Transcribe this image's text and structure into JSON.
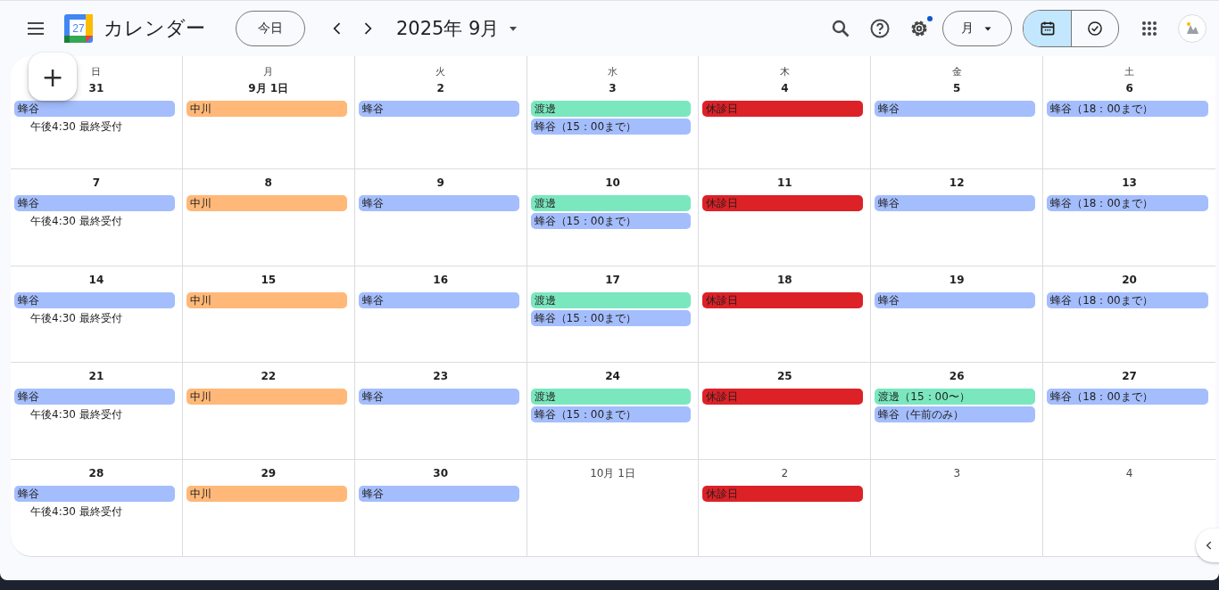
{
  "header": {
    "app_name": "カレンダー",
    "logo_day": "27",
    "today_button": "今日",
    "period": "2025年 9月",
    "settings_badge": true,
    "view_select": "月",
    "view_toggle": [
      {
        "kind": "calendar",
        "selected": true
      },
      {
        "kind": "tasks",
        "selected": false
      }
    ]
  },
  "create_button": "+",
  "weekdays": [
    "日",
    "月",
    "火",
    "水",
    "木",
    "金",
    "土"
  ],
  "weeks": [
    {
      "days": [
        {
          "date": "31",
          "dimmed": false,
          "events": [
            {
              "kind": "allday",
              "title": "蜂谷",
              "color": "#a4bdfc"
            },
            {
              "kind": "timed",
              "title": "午後4:30 最終受付"
            }
          ]
        },
        {
          "date": "9月 1日",
          "dimmed": false,
          "events": [
            {
              "kind": "allday",
              "title": "中川",
              "color": "#ffb878"
            }
          ]
        },
        {
          "date": "2",
          "dimmed": false,
          "events": [
            {
              "kind": "allday",
              "title": "蜂谷",
              "color": "#a4bdfc"
            }
          ]
        },
        {
          "date": "3",
          "dimmed": false,
          "events": [
            {
              "kind": "allday",
              "title": "渡邊",
              "color": "#7ae7bf"
            },
            {
              "kind": "allday",
              "title": "蜂谷（15：00まで）",
              "color": "#a4bdfc"
            }
          ]
        },
        {
          "date": "4",
          "dimmed": false,
          "events": [
            {
              "kind": "allday",
              "title": "休診日",
              "color": "#dc2127"
            }
          ]
        },
        {
          "date": "5",
          "dimmed": false,
          "events": [
            {
              "kind": "allday",
              "title": "蜂谷",
              "color": "#a4bdfc"
            }
          ]
        },
        {
          "date": "6",
          "dimmed": false,
          "events": [
            {
              "kind": "allday",
              "title": "蜂谷（18：00まで）",
              "color": "#a4bdfc"
            }
          ]
        }
      ]
    },
    {
      "days": [
        {
          "date": "7",
          "dimmed": false,
          "events": [
            {
              "kind": "allday",
              "title": "蜂谷",
              "color": "#a4bdfc"
            },
            {
              "kind": "timed",
              "title": "午後4:30 最終受付"
            }
          ]
        },
        {
          "date": "8",
          "dimmed": false,
          "events": [
            {
              "kind": "allday",
              "title": "中川",
              "color": "#ffb878"
            }
          ]
        },
        {
          "date": "9",
          "dimmed": false,
          "events": [
            {
              "kind": "allday",
              "title": "蜂谷",
              "color": "#a4bdfc"
            }
          ]
        },
        {
          "date": "10",
          "dimmed": false,
          "events": [
            {
              "kind": "allday",
              "title": "渡邊",
              "color": "#7ae7bf"
            },
            {
              "kind": "allday",
              "title": "蜂谷（15：00まで）",
              "color": "#a4bdfc"
            }
          ]
        },
        {
          "date": "11",
          "dimmed": false,
          "events": [
            {
              "kind": "allday",
              "title": "休診日",
              "color": "#dc2127"
            }
          ]
        },
        {
          "date": "12",
          "dimmed": false,
          "events": [
            {
              "kind": "allday",
              "title": "蜂谷",
              "color": "#a4bdfc"
            }
          ]
        },
        {
          "date": "13",
          "dimmed": false,
          "events": [
            {
              "kind": "allday",
              "title": "蜂谷（18：00まで）",
              "color": "#a4bdfc"
            }
          ]
        }
      ]
    },
    {
      "days": [
        {
          "date": "14",
          "dimmed": false,
          "events": [
            {
              "kind": "allday",
              "title": "蜂谷",
              "color": "#a4bdfc"
            },
            {
              "kind": "timed",
              "title": "午後4:30 最終受付"
            }
          ]
        },
        {
          "date": "15",
          "dimmed": false,
          "events": [
            {
              "kind": "allday",
              "title": "中川",
              "color": "#ffb878"
            }
          ]
        },
        {
          "date": "16",
          "dimmed": false,
          "events": [
            {
              "kind": "allday",
              "title": "蜂谷",
              "color": "#a4bdfc"
            }
          ]
        },
        {
          "date": "17",
          "dimmed": false,
          "events": [
            {
              "kind": "allday",
              "title": "渡邊",
              "color": "#7ae7bf"
            },
            {
              "kind": "allday",
              "title": "蜂谷（15：00まで）",
              "color": "#a4bdfc"
            }
          ]
        },
        {
          "date": "18",
          "dimmed": false,
          "events": [
            {
              "kind": "allday",
              "title": "休診日",
              "color": "#dc2127"
            }
          ]
        },
        {
          "date": "19",
          "dimmed": false,
          "events": [
            {
              "kind": "allday",
              "title": "蜂谷",
              "color": "#a4bdfc"
            }
          ]
        },
        {
          "date": "20",
          "dimmed": false,
          "events": [
            {
              "kind": "allday",
              "title": "蜂谷（18：00まで）",
              "color": "#a4bdfc"
            }
          ]
        }
      ]
    },
    {
      "days": [
        {
          "date": "21",
          "dimmed": false,
          "events": [
            {
              "kind": "allday",
              "title": "蜂谷",
              "color": "#a4bdfc"
            },
            {
              "kind": "timed",
              "title": "午後4:30 最終受付"
            }
          ]
        },
        {
          "date": "22",
          "dimmed": false,
          "events": [
            {
              "kind": "allday",
              "title": "中川",
              "color": "#ffb878"
            }
          ]
        },
        {
          "date": "23",
          "dimmed": false,
          "events": [
            {
              "kind": "allday",
              "title": "蜂谷",
              "color": "#a4bdfc"
            }
          ]
        },
        {
          "date": "24",
          "dimmed": false,
          "events": [
            {
              "kind": "allday",
              "title": "渡邊",
              "color": "#7ae7bf"
            },
            {
              "kind": "allday",
              "title": "蜂谷（15：00まで）",
              "color": "#a4bdfc"
            }
          ]
        },
        {
          "date": "25",
          "dimmed": false,
          "events": [
            {
              "kind": "allday",
              "title": "休診日",
              "color": "#dc2127"
            }
          ]
        },
        {
          "date": "26",
          "dimmed": false,
          "events": [
            {
              "kind": "allday",
              "title": "渡邊（15：00〜）",
              "color": "#7ae7bf"
            },
            {
              "kind": "allday",
              "title": "蜂谷（午前のみ）",
              "color": "#a4bdfc"
            }
          ]
        },
        {
          "date": "27",
          "dimmed": false,
          "events": [
            {
              "kind": "allday",
              "title": "蜂谷（18：00まで）",
              "color": "#a4bdfc"
            }
          ]
        }
      ]
    },
    {
      "days": [
        {
          "date": "28",
          "dimmed": false,
          "events": [
            {
              "kind": "allday",
              "title": "蜂谷",
              "color": "#a4bdfc"
            },
            {
              "kind": "timed",
              "title": "午後4:30 最終受付"
            }
          ]
        },
        {
          "date": "29",
          "dimmed": false,
          "events": [
            {
              "kind": "allday",
              "title": "中川",
              "color": "#ffb878"
            }
          ]
        },
        {
          "date": "30",
          "dimmed": false,
          "events": [
            {
              "kind": "allday",
              "title": "蜂谷",
              "color": "#a4bdfc"
            }
          ]
        },
        {
          "date": "10月 1日",
          "dimmed": true
        },
        {
          "date": "2",
          "dimmed": true,
          "events": [
            {
              "kind": "allday",
              "title": "休診日",
              "color": "#dc2127"
            }
          ]
        },
        {
          "date": "3",
          "dimmed": true
        },
        {
          "date": "4",
          "dimmed": true
        }
      ]
    }
  ]
}
